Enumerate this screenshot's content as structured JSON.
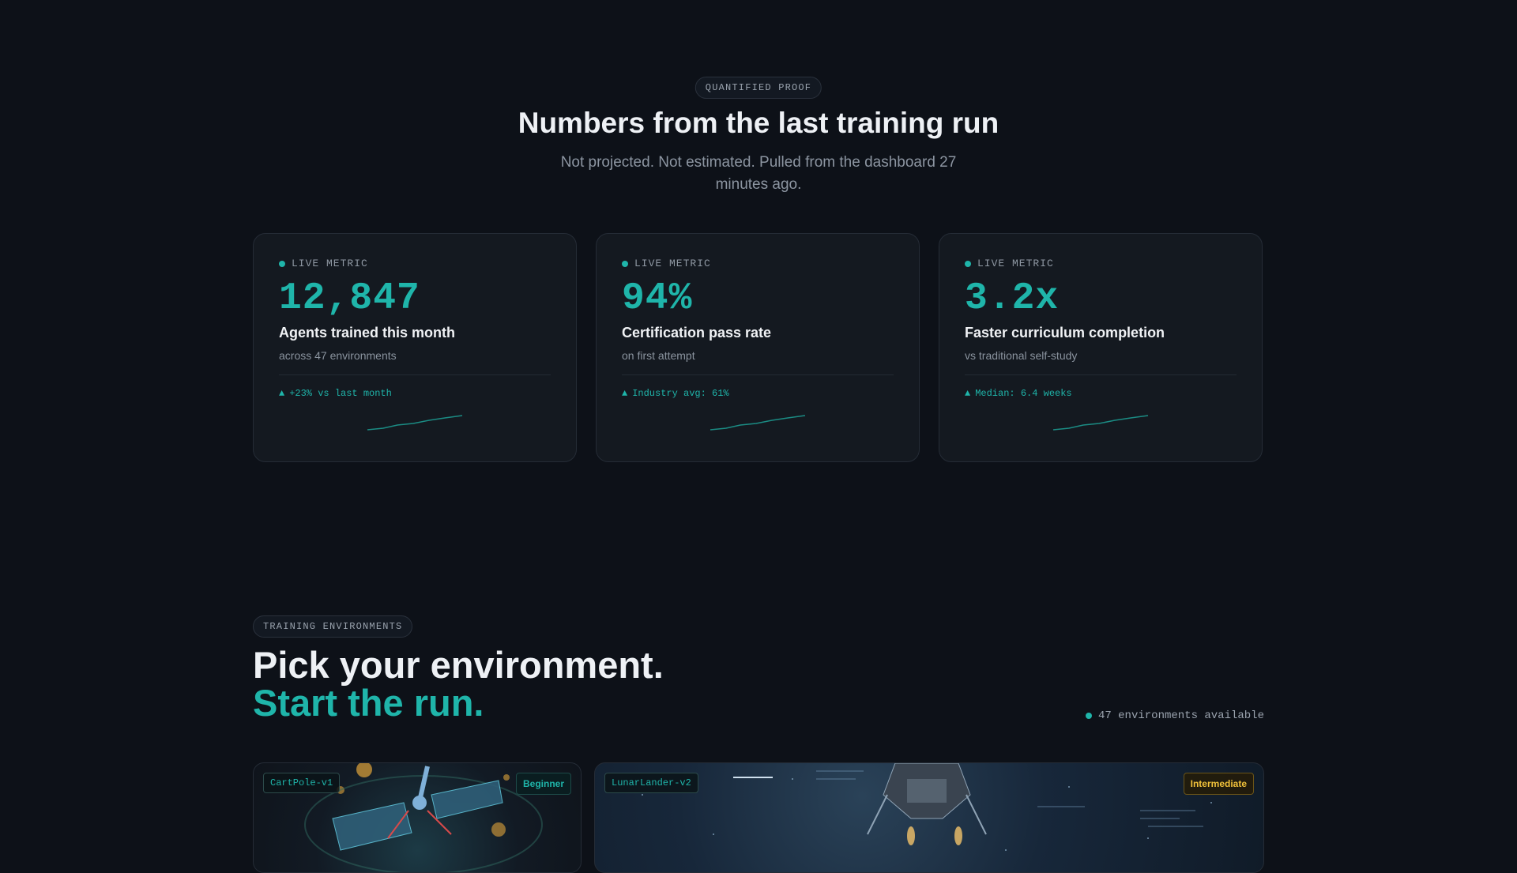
{
  "proof": {
    "eyebrow": "QUANTIFIED PROOF",
    "title": "Numbers from the last training run",
    "subtitle": "Not projected. Not estimated. Pulled from the dashboard 27 minutes ago."
  },
  "metrics": [
    {
      "tag": "LIVE METRIC",
      "value": "12,847",
      "label": "Agents trained this month",
      "detail": "across 47 environments",
      "trend": "+23% vs last month"
    },
    {
      "tag": "LIVE METRIC",
      "value": "94%",
      "label": "Certification pass rate",
      "detail": "on first attempt",
      "trend": "Industry avg: 61%"
    },
    {
      "tag": "LIVE METRIC",
      "value": "3.2x",
      "label": "Faster curriculum completion",
      "detail": "vs traditional self-study",
      "trend": "Median: 6.4 weeks"
    }
  ],
  "environments": {
    "eyebrow": "TRAINING ENVIRONMENTS",
    "title_line1": "Pick your environment.",
    "title_line2": "Start the run.",
    "count": "47 environments available",
    "cards": [
      {
        "name": "CartPole-v1",
        "level": "Beginner"
      },
      {
        "name": "LunarLander-v2",
        "level": "Intermediate"
      }
    ]
  },
  "colors": {
    "background": "#0d1118",
    "accent": "#1fb5aa",
    "intermediate": "#f2c23a"
  },
  "icons": {
    "live": "dot-icon",
    "trend": "triangle-up-icon"
  }
}
